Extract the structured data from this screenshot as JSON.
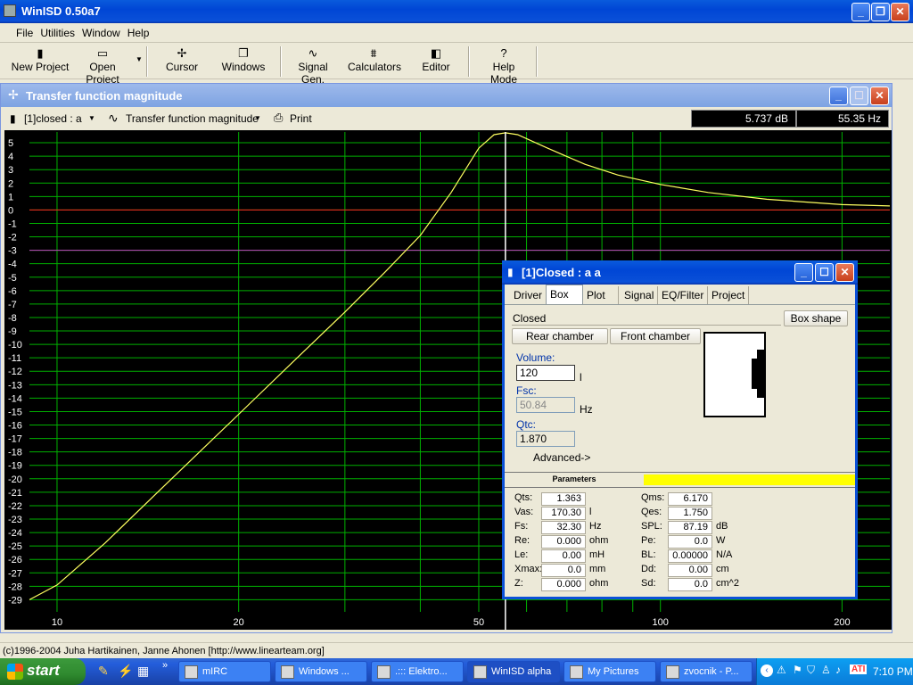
{
  "app": {
    "title": "WinISD 0.50a7"
  },
  "menu": [
    "File",
    "Utilities",
    "Window",
    "Help"
  ],
  "toolbar": {
    "new_project": "New Project",
    "open_project": "Open Project",
    "cursor": "Cursor",
    "windows": "Windows",
    "signal_gen": "Signal Gen.",
    "calculators": "Calculators",
    "editor": "Editor",
    "help_mode": "Help Mode"
  },
  "child": {
    "title": "Transfer function magnitude",
    "project_select": "[1]closed : a",
    "plot_select": "Transfer function magnitude",
    "print": "Print",
    "readout_db": "5.737 dB",
    "readout_hz": "55.35 Hz"
  },
  "chart_data": {
    "type": "line",
    "x_scale": "log",
    "xlim": [
      9,
      240
    ],
    "ylim": [
      -29.9,
      5.8
    ],
    "x_tick_labels": [
      "10",
      "20",
      "50",
      "100",
      "200"
    ],
    "y_ticks": [
      5,
      4,
      3,
      2,
      1,
      0,
      -1,
      -2,
      -3,
      -4,
      -5,
      -6,
      -7,
      -8,
      -9,
      -10,
      -11,
      -12,
      -13,
      -14,
      -15,
      -16,
      -17,
      -18,
      -19,
      -20,
      -21,
      -22,
      -23,
      -24,
      -25,
      -26,
      -27,
      -28,
      -29
    ],
    "cursor_x": 55.35,
    "reference_lines": [
      0,
      -3
    ],
    "grid": true,
    "colors": {
      "background": "#000000",
      "grid": "#00b000",
      "curve": "#ffff60",
      "zero_line": "#ff2020",
      "minus3_line": "#c040c0",
      "cursor": "#ffffff"
    },
    "series": [
      {
        "points": [
          [
            9,
            -29
          ],
          [
            10,
            -27.9
          ],
          [
            12,
            -24.8
          ],
          [
            15,
            -20.6
          ],
          [
            20,
            -15.2
          ],
          [
            25,
            -11
          ],
          [
            30,
            -7.6
          ],
          [
            35,
            -4.6
          ],
          [
            40,
            -1.9
          ],
          [
            45,
            1.3
          ],
          [
            50,
            4.6
          ],
          [
            53,
            5.6
          ],
          [
            55.35,
            5.737
          ],
          [
            58,
            5.6
          ],
          [
            65,
            4.6
          ],
          [
            75,
            3.4
          ],
          [
            85,
            2.6
          ],
          [
            100,
            1.9
          ],
          [
            120,
            1.3
          ],
          [
            150,
            0.8
          ],
          [
            200,
            0.4
          ],
          [
            240,
            0.3
          ]
        ]
      }
    ]
  },
  "dialog": {
    "title": "[1]Closed : a a",
    "tabs": [
      "Driver",
      "Box",
      "Plot",
      "Signal",
      "EQ/Filter",
      "Project"
    ],
    "box_type": "Closed",
    "box_shape_btn": "Box shape",
    "rear_chamber_btn": "Rear chamber",
    "front_chamber_btn": "Front chamber",
    "volume_label": "Volume:",
    "volume_value": "120",
    "volume_unit": "l",
    "fsc_label": "Fsc:",
    "fsc_value": "50.84",
    "fsc_unit": "Hz",
    "qtc_label": "Qtc:",
    "qtc_value": "1.870",
    "advanced_btn": "Advanced->",
    "params_header": "Parameters",
    "params_left": [
      {
        "name": "Qts:",
        "value": "1.363",
        "unit": ""
      },
      {
        "name": "Vas:",
        "value": "170.30",
        "unit": "l"
      },
      {
        "name": "Fs:",
        "value": "32.30",
        "unit": "Hz"
      },
      {
        "name": "Re:",
        "value": "0.000",
        "unit": "ohm"
      },
      {
        "name": "Le:",
        "value": "0.00",
        "unit": "mH"
      },
      {
        "name": "Xmax:",
        "value": "0.0",
        "unit": "mm"
      },
      {
        "name": "Z:",
        "value": "0.000",
        "unit": "ohm"
      }
    ],
    "params_right": [
      {
        "name": "Qms:",
        "value": "6.170",
        "unit": ""
      },
      {
        "name": "Qes:",
        "value": "1.750",
        "unit": ""
      },
      {
        "name": "SPL:",
        "value": "87.19",
        "unit": "dB"
      },
      {
        "name": "Pe:",
        "value": "0.0",
        "unit": "W"
      },
      {
        "name": "BL:",
        "value": "0.00000",
        "unit": "N/A"
      },
      {
        "name": "Dd:",
        "value": "0.00",
        "unit": "cm"
      },
      {
        "name": "Sd:",
        "value": "0.0",
        "unit": "cm^2"
      }
    ]
  },
  "statusbar": "(c)1996-2004 Juha Hartikainen, Janne Ahonen [http://www.linearteam.org]",
  "taskbar": {
    "start": "start",
    "tasks": [
      "mIRC",
      "Windows ...",
      ".::: Elektro...",
      "WinISD alpha",
      "My Pictures",
      "zvocnik - P..."
    ],
    "clock": "7:10 PM"
  }
}
